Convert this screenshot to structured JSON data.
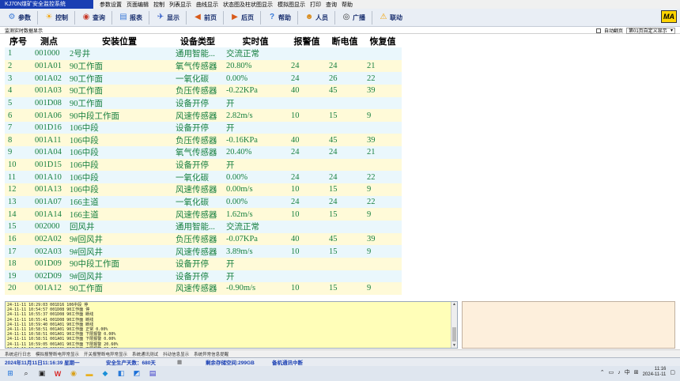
{
  "app": {
    "title": "KJ70N煤矿安全监控系统",
    "menus": [
      "参数设置",
      "页面编辑",
      "控制",
      "列表显示",
      "曲线显示",
      "状态图及柱状图显示",
      "模拟图显示",
      "打印",
      "查询",
      "帮助"
    ]
  },
  "toolbar": {
    "buttons": [
      {
        "label": "参数",
        "icon": "gear-icon",
        "color": "#3a7ad8"
      },
      {
        "label": "控制",
        "icon": "sun-icon",
        "color": "#f3a100"
      },
      {
        "label": "查询",
        "icon": "search-icon",
        "color": "#c83a2a"
      },
      {
        "label": "报表",
        "icon": "report-icon",
        "color": "#3a7ad8"
      },
      {
        "label": "显示",
        "icon": "display-icon",
        "color": "#2a58c8"
      },
      {
        "label": "前页",
        "icon": "prev-icon",
        "color": "#d85a1a"
      },
      {
        "label": "后页",
        "icon": "next-icon",
        "color": "#d85a1a"
      },
      {
        "label": "帮助",
        "icon": "help-icon",
        "color": "#3a7ad8"
      },
      {
        "label": "人员",
        "icon": "people-icon",
        "color": "#d88a1a"
      },
      {
        "label": "广播",
        "icon": "broadcast-icon",
        "color": "#333333"
      },
      {
        "label": "联动",
        "icon": "linkage-icon",
        "color": "#f3a100"
      }
    ],
    "brand": "MA"
  },
  "subheader": {
    "left_label": "监测实时数据显示",
    "auto_page_label": "自动翻页",
    "page_select_value": "第01页自定义显示"
  },
  "table": {
    "headers": [
      "序号",
      "测点",
      "安装位置",
      "设备类型",
      "实时值",
      "报警值",
      "断电值",
      "恢复值"
    ],
    "rows": [
      [
        "1",
        "001000",
        "2号井",
        "通用智能...",
        "交流正常",
        "",
        "",
        ""
      ],
      [
        "2",
        "001A01",
        "90工作面",
        "氧气传感器",
        "20.80%",
        "24",
        "24",
        "21"
      ],
      [
        "3",
        "001A02",
        "90工作面",
        "一氧化碳",
        "0.00%",
        "24",
        "26",
        "22"
      ],
      [
        "4",
        "001A03",
        "90工作面",
        "负压传感器",
        "-0.22KPa",
        "40",
        "45",
        "39"
      ],
      [
        "5",
        "001D08",
        "90工作面",
        "设备开停",
        "开",
        "",
        "",
        ""
      ],
      [
        "6",
        "001A06",
        "90中段工作面",
        "风速传感器",
        "2.82m/s",
        "10",
        "15",
        "9"
      ],
      [
        "7",
        "001D16",
        "106中段",
        "设备开停",
        "开",
        "",
        "",
        ""
      ],
      [
        "8",
        "001A11",
        "106中段",
        "负压传感器",
        "-0.16KPa",
        "40",
        "45",
        "39"
      ],
      [
        "9",
        "001A04",
        "106中段",
        "氧气传感器",
        "20.40%",
        "24",
        "24",
        "21"
      ],
      [
        "10",
        "001D15",
        "106中段",
        "设备开停",
        "开",
        "",
        "",
        ""
      ],
      [
        "11",
        "001A10",
        "106中段",
        "一氧化碳",
        "0.00%",
        "24",
        "24",
        "22"
      ],
      [
        "12",
        "001A13",
        "106中段",
        "风速传感器",
        "0.00m/s",
        "10",
        "15",
        "9"
      ],
      [
        "13",
        "001A07",
        "166主道",
        "一氧化碳",
        "0.00%",
        "24",
        "24",
        "22"
      ],
      [
        "14",
        "001A14",
        "166主道",
        "风速传感器",
        "1.62m/s",
        "10",
        "15",
        "9"
      ],
      [
        "15",
        "002000",
        "回风井",
        "通用智能...",
        "交流正常",
        "",
        "",
        ""
      ],
      [
        "16",
        "002A02",
        "9#回风井",
        "负压传感器",
        "-0.07KPa",
        "40",
        "45",
        "39"
      ],
      [
        "17",
        "002A03",
        "9#回风井",
        "风速传感器",
        "3.89m/s",
        "10",
        "15",
        "9"
      ],
      [
        "18",
        "001D09",
        "90中段工作面",
        "设备开停",
        "开",
        "",
        "",
        ""
      ],
      [
        "19",
        "002D09",
        "9#回风井",
        "设备开停",
        "开",
        "",
        "",
        ""
      ],
      [
        "20",
        "001A12",
        "90工作面",
        "风速传感器",
        "-0.90m/s",
        "10",
        "15",
        "9"
      ]
    ]
  },
  "log": {
    "lines": [
      "24-11-11 10:29:03  001D16  106中段  停",
      "24-11-11 10:54:57  001D08  90工作面  停",
      "24-11-11 10:55:37  001D08  90工作面  断线",
      "24-11-11 10:55:41  001D08  90工作面  断线",
      "24-11-11 10:59:40  001A01  90工作面  断线",
      "24-11-11 10:58:51  001A01  90工作面  正常 0.00%",
      "24-11-11 10:58:51  001A01  90工作面  下限报警 0.00%",
      "24-11-11 10:58:51  001A01  90工作面  下限报警 0.00%",
      "24-11-11 10:59:05  001A01  90工作面  下限报警 20.60%",
      "24-11-11 10:59:06  001A01  90工作面  下限报警 20.60%",
      "24-11-11 11:03:53  001A03  90工作面  正常 0.00KPa"
    ]
  },
  "log_tabs": [
    "系统运行日志",
    "模拟报警断电异常显示",
    "开关报警断电异常显示",
    "系统通讯测试",
    "抖动信息显示",
    "系统异常信息提醒"
  ],
  "status": {
    "datetime": "2024年11月11日11:16:39 星期一",
    "safe_days": "安全生产天数：680天",
    "disk_free": "剩余存储空间:299GB",
    "comm_status": "备机通讯中断"
  },
  "taskbar": {
    "time": "11:16",
    "date": "2024-11-11",
    "lang": "中"
  }
}
